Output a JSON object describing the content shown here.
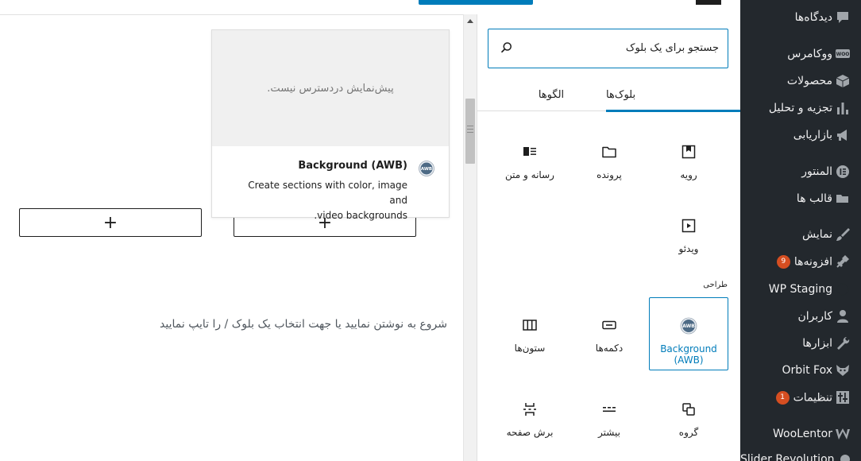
{
  "editor": {
    "canvas_placeholder": "شروع به نوشتن نمایید یا جهت انتخاب یک بلوک / را تایپ نمایید",
    "appender_label": "+"
  },
  "preview": {
    "no_preview": "پیش‌نمایش دردسترس نیست.",
    "title": "Background (AWB)",
    "description_line1": "Create sections with color, image and",
    "description_line2": ".video backgrounds",
    "icon_text": "AWB"
  },
  "inserter": {
    "search": {
      "placeholder": "جستجو برای یک بلوک",
      "value": ""
    },
    "tabs": {
      "blocks": "بلوک‌ها",
      "patterns": "الگوها"
    },
    "section_design": "طراحی",
    "blocks": {
      "cover": "رویه",
      "file": "پرونده",
      "media_text": "رسانه و متن",
      "video": "ویدئو",
      "awb_line1": "Background",
      "awb_line2": "(AWB)",
      "buttons": "دکمه‌ها",
      "columns": "ستون‌ها",
      "group": "گروه",
      "more": "بیشتر",
      "page_break": "برش صفحه"
    }
  },
  "admin_menu": {
    "comments": "دیدگاه‌ها",
    "woocommerce": "ووکامرس",
    "products": "محصولات",
    "analytics": "تجزیه و تحلیل",
    "marketing": "بازاریابی",
    "elementor": "المنتور",
    "templates": "قالب ها",
    "appearance": "نمایش",
    "plugins": "افزونه‌ها",
    "plugins_badge": "9",
    "wp_staging": "WP Staging",
    "users": "کاربران",
    "tools": "ابزارها",
    "orbit_fox": "Orbit Fox",
    "settings": "تنظیمات",
    "settings_badge": "1",
    "woolentor": "WooLentor",
    "slider_revolution": "Slider Revolution"
  },
  "colors": {
    "accent": "#007cba",
    "admin_bg": "#23282d",
    "badge": "#d54e21"
  }
}
